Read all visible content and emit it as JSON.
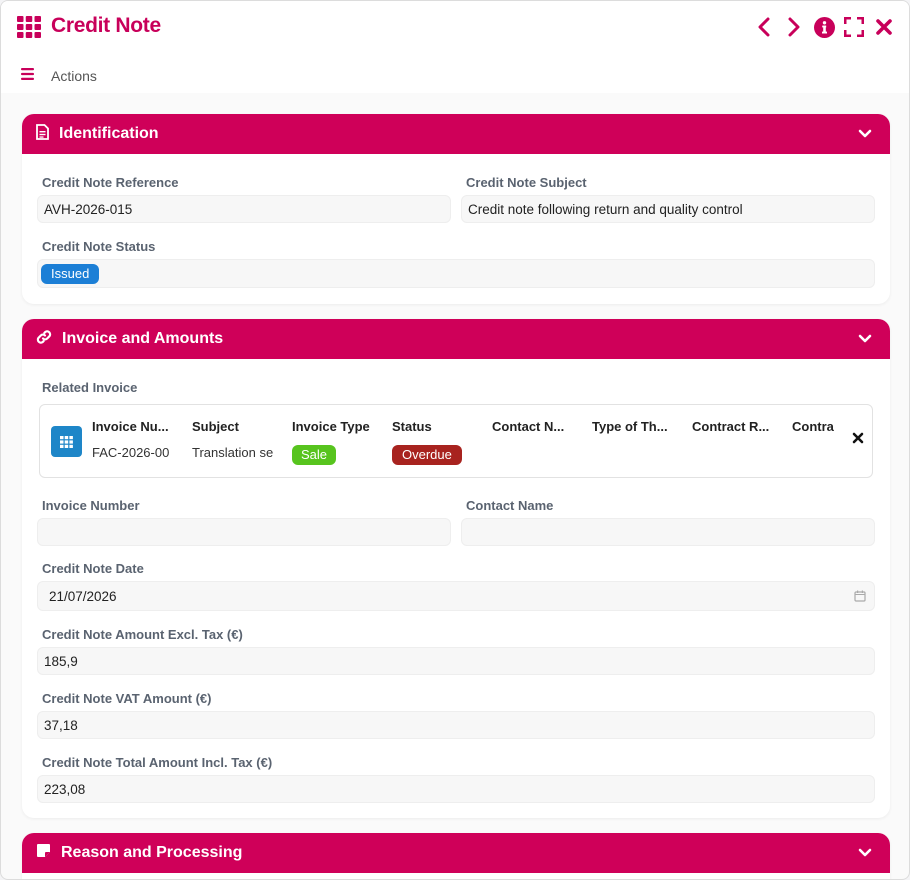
{
  "header": {
    "title": "Credit Note",
    "actions_label": "Actions",
    "brand_color": "#c8005a"
  },
  "identification": {
    "title": "Identification",
    "reference_label": "Credit Note Reference",
    "reference_value": "AVH-2026-015",
    "subject_label": "Credit Note Subject",
    "subject_value": "Credit note following return and quality control",
    "status_label": "Credit Note Status",
    "status_value": "Issued"
  },
  "invoice": {
    "title": "Invoice and Amounts",
    "related_label": "Related Invoice",
    "related_columns": [
      "Invoice Nu...",
      "Subject",
      "Invoice Type",
      "Status",
      "Contact N...",
      "Type of Th...",
      "Contract R...",
      "Contra"
    ],
    "related_row": {
      "invoice_number": "FAC-2026-00",
      "subject": "Translation se",
      "invoice_type": "Sale",
      "status": "Overdue"
    },
    "invoice_number_label": "Invoice Number",
    "invoice_number_value": "",
    "contact_name_label": "Contact Name",
    "contact_name_value": "",
    "date_label": "Credit Note Date",
    "date_value": "21/07/2026",
    "amount_excl_label": "Credit Note Amount Excl. Tax (€)",
    "amount_excl_value": "185,9",
    "vat_label": "Credit Note VAT Amount (€)",
    "vat_value": "37,18",
    "total_label": "Credit Note Total Amount Incl. Tax (€)",
    "total_value": "223,08"
  },
  "reason": {
    "title": "Reason and Processing"
  },
  "colors": {
    "section_header": "#cf0059",
    "badge_issued": "#1c7fd6",
    "badge_sale": "#57c41e",
    "badge_overdue": "#a8231f",
    "related_icon": "#1e86c8"
  },
  "icons": [
    "grid-icon",
    "chevron-left-icon",
    "chevron-right-icon",
    "info-icon",
    "fullscreen-icon",
    "close-icon",
    "menu-icon",
    "document-icon",
    "link-icon",
    "note-icon",
    "chevron-down-icon",
    "calendar-icon",
    "table-icon"
  ]
}
